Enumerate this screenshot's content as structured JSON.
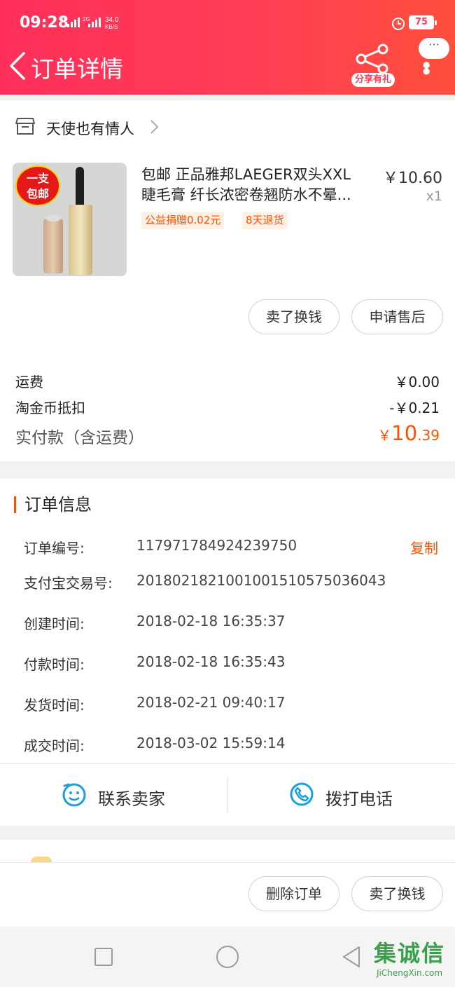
{
  "status_bar": {
    "time": "09:28",
    "network_signal": "4G",
    "network_signal2": "2G",
    "speed_value": "34.0",
    "speed_unit": "KB/S",
    "battery": "75"
  },
  "nav": {
    "title": "订单详情",
    "share_label": "分享有礼",
    "more_bubble": "···"
  },
  "shop": {
    "name": "天使也有情人"
  },
  "product": {
    "title_line1": "包邮 正品雅邦LAEGER双头XXL",
    "title_line2": "睫毛膏  纤长浓密卷翘防水不晕...",
    "price": "￥10.60",
    "quantity": "x1",
    "sticker_line1": "一支",
    "sticker_line2": "包邮",
    "tags": [
      "公益捐赠0.02元",
      "8天退货"
    ],
    "actions": [
      "卖了换钱",
      "申请售后"
    ]
  },
  "fees": {
    "shipping_label": "运费",
    "shipping_value": "￥0.00",
    "coin_label": "淘金币抵扣",
    "coin_value": "-￥0.21",
    "paid_label": "实付款（含运费）",
    "paid_yen": "￥",
    "paid_int": "10",
    "paid_dec": ".39"
  },
  "order_info": {
    "title": "订单信息",
    "copy_label": "复制",
    "rows": [
      {
        "label": "订单编号:",
        "value": "117971784924239750"
      },
      {
        "label": "支付宝交易号:",
        "value": "2018021821001001510575036043"
      },
      {
        "label": "创建时间:",
        "value": "2018-02-18 16:35:37"
      },
      {
        "label": "付款时间:",
        "value": "2018-02-18 16:35:43"
      },
      {
        "label": "发货时间:",
        "value": "2018-02-21 09:40:17"
      },
      {
        "label": "成交时间:",
        "value": "2018-03-02 15:59:14"
      }
    ],
    "contact_seller": "联系卖家",
    "call_phone": "拨打电话"
  },
  "bottom_actions": [
    "删除订单",
    "卖了换钱"
  ],
  "watermark": {
    "text": "集诚信",
    "domain": "JiChengXin.com"
  },
  "colors": {
    "brand": "#ff3d55",
    "accent": "#ff5000",
    "icon_blue": "#1aa0dc"
  }
}
